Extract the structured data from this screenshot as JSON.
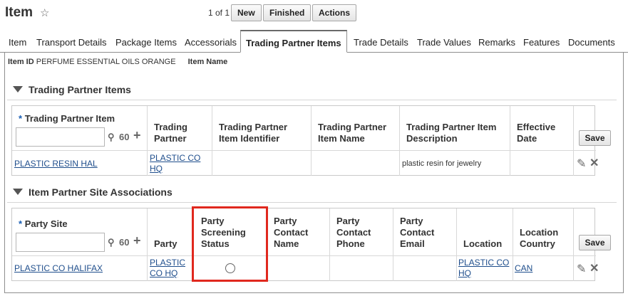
{
  "header": {
    "title": "Item",
    "star_icon": "star-outline-icon",
    "pager": "1 of 1",
    "buttons": {
      "new": "New",
      "finished": "Finished",
      "actions": "Actions"
    }
  },
  "tabs": [
    "Item",
    "Transport Details",
    "Package Items",
    "Accessorials",
    "Trading Partner Items",
    "Trade Details",
    "Trade Values",
    "Remarks",
    "Features",
    "Documents"
  ],
  "active_tab": "Trading Partner Items",
  "item_line": {
    "id_label": "Item ID",
    "id_value": "PERFUME ESSENTIAL OILS ORANGE",
    "name_label": "Item Name"
  },
  "tp_section": {
    "title": "Trading Partner Items",
    "required_marker": "*",
    "columns": [
      "Trading Partner Item",
      "Trading Partner",
      "Trading Partner Item Identifier",
      "Trading Partner Item Name",
      "Trading Partner Item Description",
      "Effective Date"
    ],
    "save_label": "Save",
    "row": {
      "item": "PLASTIC RESIN HAL",
      "partner": "PLASTIC CO HQ",
      "identifier": "",
      "name": "",
      "description": "plastic resin for jewelry",
      "effective_date": ""
    }
  },
  "site_section": {
    "title": "Item Partner Site Associations",
    "required_marker": "*",
    "columns": [
      "Party Site",
      "Party",
      "Party Screening Status",
      "Party Contact Name",
      "Party Contact Phone",
      "Party Contact Email",
      "Location",
      "Location Country"
    ],
    "save_label": "Save",
    "row": {
      "site": "PLASTIC CO HALIFAX",
      "party": "PLASTIC CO HQ",
      "contact_name": "",
      "contact_phone": "",
      "contact_email": "",
      "location": "PLASTIC CO HQ",
      "country": "CAN"
    }
  },
  "icons": {
    "search": "search-icon",
    "binoculars": "binoculars-icon",
    "add": "plus-icon",
    "edit": "pencil-icon",
    "delete": "close-x-icon",
    "collapse": "triangle-down-icon",
    "screening": "empty-circle-icon"
  },
  "colors": {
    "link": "#1f4e8c",
    "required": "#1a5fb4",
    "highlight": "#e0281e"
  }
}
